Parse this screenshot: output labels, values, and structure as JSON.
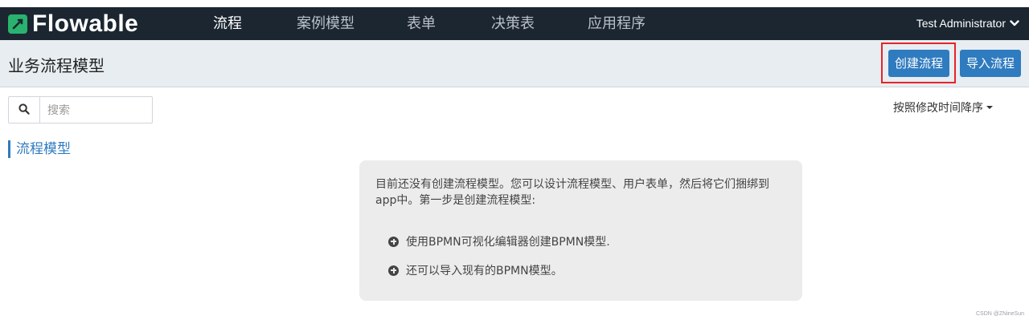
{
  "app": {
    "logo_text": "Flowable"
  },
  "nav": {
    "items": [
      {
        "label": "流程",
        "active": true
      },
      {
        "label": "案例模型",
        "active": false
      },
      {
        "label": "表单",
        "active": false
      },
      {
        "label": "决策表",
        "active": false
      },
      {
        "label": "应用程序",
        "active": false
      }
    ],
    "user_label": "Test Administrator"
  },
  "header": {
    "title": "业务流程模型",
    "create_button": "创建流程",
    "import_button": "导入流程"
  },
  "search": {
    "placeholder": "搜索",
    "value": ""
  },
  "sort": {
    "label": "按照修改时间降序"
  },
  "section": {
    "title": "流程模型"
  },
  "empty_state": {
    "intro": "目前还没有创建流程模型。您可以设计流程模型、用户表单，然后将它们捆绑到app中。第一步是创建流程模型:",
    "items": [
      "使用BPMN可视化编辑器创建BPMN模型.",
      "还可以导入现有的BPMN模型。"
    ]
  },
  "watermark": "CSDN @ZNineSun",
  "colors": {
    "navbar": "#1b2631",
    "accent": "#2f7bbf",
    "logo_green": "#29b36f",
    "highlight_red": "#e3242b"
  },
  "icons": [
    "flowable-logo-icon",
    "chevron-down-icon",
    "search-icon",
    "caret-down-icon",
    "plus-circle-icon"
  ]
}
